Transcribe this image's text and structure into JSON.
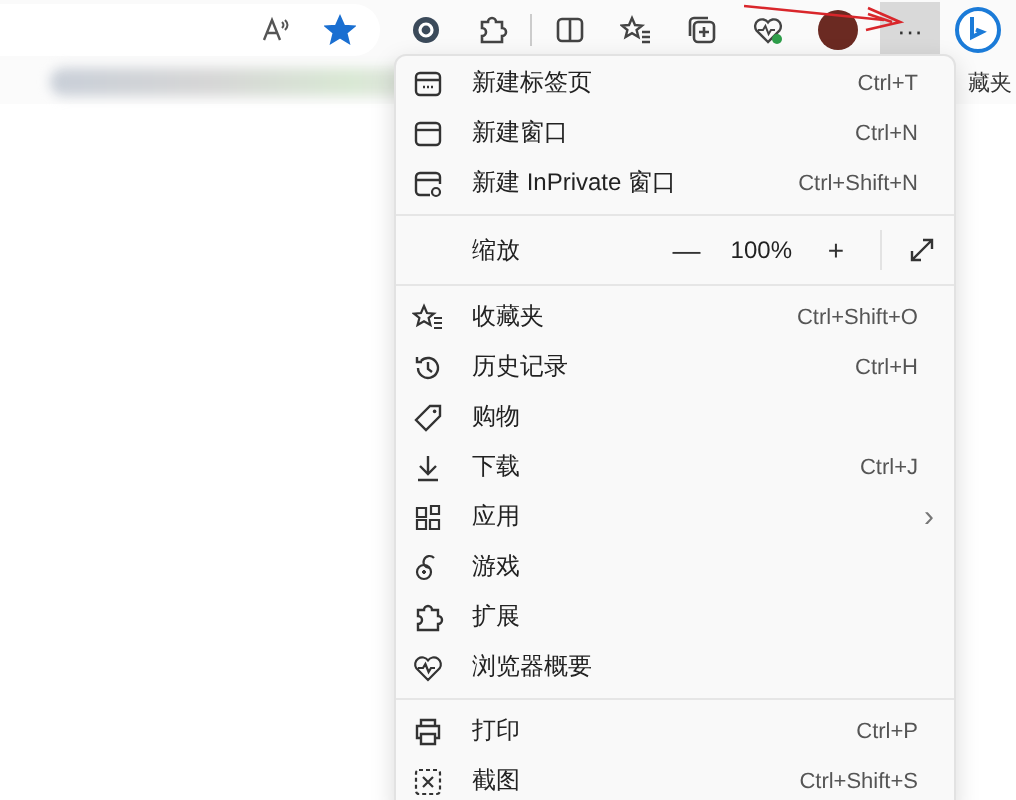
{
  "toolbar": {
    "more_button": {
      "label": "···",
      "active": true
    },
    "favorite_on": true
  },
  "bookmarks_bar": {
    "visible_text": "藏夹"
  },
  "menu": {
    "items": [
      {
        "kind": "item",
        "label": "新建标签页",
        "shortcut": "Ctrl+T"
      },
      {
        "kind": "item",
        "label": "新建窗口",
        "shortcut": "Ctrl+N"
      },
      {
        "kind": "item",
        "label": "新建 InPrivate 窗口",
        "shortcut": "Ctrl+Shift+N"
      },
      {
        "kind": "separator"
      },
      {
        "kind": "zoom",
        "label": "缩放",
        "minus": "—",
        "value": "100%",
        "plus": "+"
      },
      {
        "kind": "separator"
      },
      {
        "kind": "item",
        "label": "收藏夹",
        "shortcut": "Ctrl+Shift+O"
      },
      {
        "kind": "item",
        "label": "历史记录",
        "shortcut": "Ctrl+H"
      },
      {
        "kind": "item",
        "label": "购物"
      },
      {
        "kind": "item",
        "label": "下载",
        "shortcut": "Ctrl+J"
      },
      {
        "kind": "item",
        "label": "应用",
        "chevron": "›"
      },
      {
        "kind": "item",
        "label": "游戏"
      },
      {
        "kind": "item",
        "label": "扩展"
      },
      {
        "kind": "item",
        "label": "浏览器概要"
      },
      {
        "kind": "separator"
      },
      {
        "kind": "item",
        "label": "打印",
        "shortcut": "Ctrl+P"
      },
      {
        "kind": "item",
        "label": "截图",
        "shortcut": "Ctrl+Shift+S"
      }
    ]
  }
}
